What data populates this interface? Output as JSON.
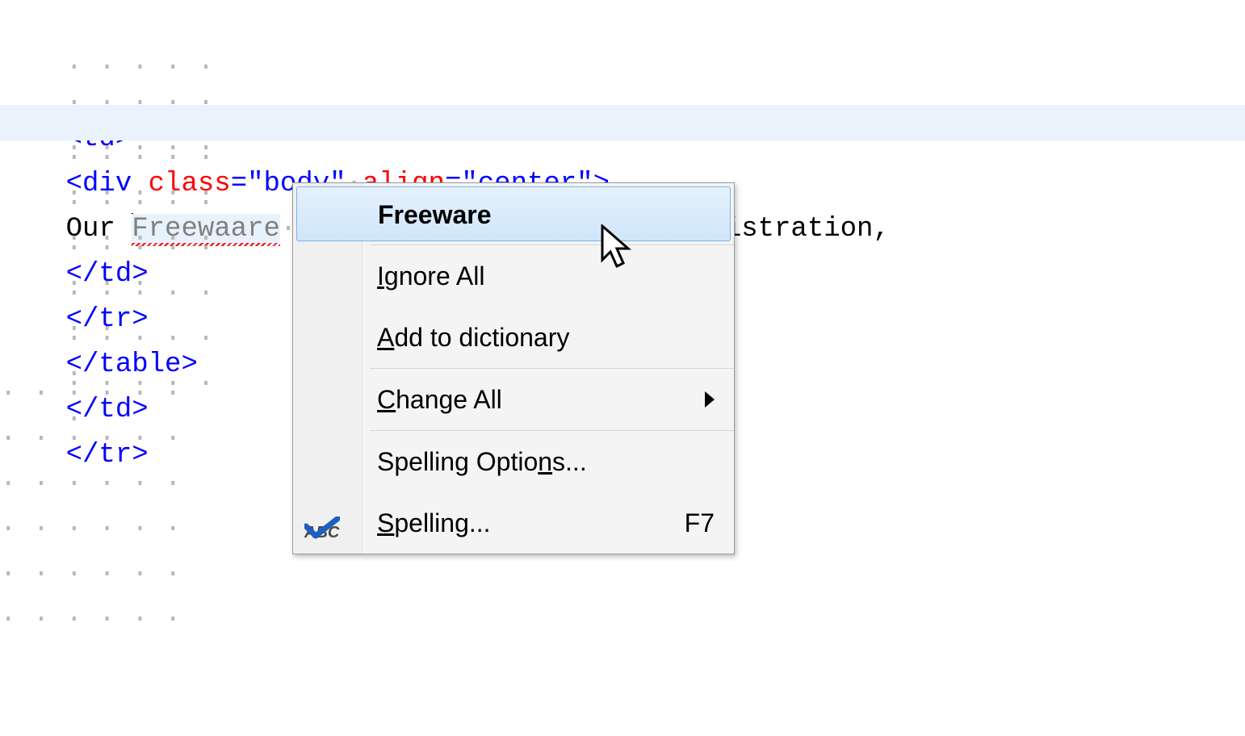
{
  "code": {
    "lines": [
      {
        "indent": 5,
        "segments": [
          {
            "cls": "tag",
            "text": "<td>"
          }
        ]
      },
      {
        "indent": 5,
        "segments": [
          {
            "cls": "tag",
            "text": "<div "
          },
          {
            "cls": "attr",
            "text": "class"
          },
          {
            "cls": "tag",
            "text": "="
          },
          {
            "cls": "val",
            "text": "\"body\""
          },
          {
            "cls": "tag",
            "text": " "
          },
          {
            "cls": "attr",
            "text": "align"
          },
          {
            "cls": "tag",
            "text": "="
          },
          {
            "cls": "val",
            "text": "\"center\""
          },
          {
            "cls": "tag",
            "text": ">"
          }
        ]
      },
      {
        "indent": 5,
        "highlight": true,
        "segments": [
          {
            "cls": "txt",
            "text": "Our "
          },
          {
            "cls": "miss",
            "text": "Freewaare"
          },
          {
            "cls": "txt",
            "text": " products don't require registration,"
          }
        ]
      },
      {
        "indent": 5,
        "segments": [
          {
            "cls": "tag",
            "text": "</td>"
          }
        ]
      },
      {
        "indent": 4,
        "segments": [
          {
            "cls": "tag",
            "text": "</tr>"
          }
        ]
      },
      {
        "indent": 3,
        "segments": [
          {
            "cls": "tag",
            "text": "</table>"
          }
        ]
      },
      {
        "indent": 2,
        "segments": [
          {
            "cls": "tag",
            "text": "</td>"
          }
        ]
      },
      {
        "indent": 2,
        "segments": [
          {
            "cls": "tag",
            "text": "</tr>"
          }
        ]
      }
    ],
    "misspelled_word": "Freewaare"
  },
  "menu": {
    "suggestion": "Freeware",
    "ignore_all": "Ignore All",
    "add_to_dictionary": "Add to dictionary",
    "change_all": "Change All",
    "spelling_options": "Spelling Options...",
    "spelling": "Spelling...",
    "spelling_shortcut": "F7",
    "icon_abc": "ABC"
  }
}
